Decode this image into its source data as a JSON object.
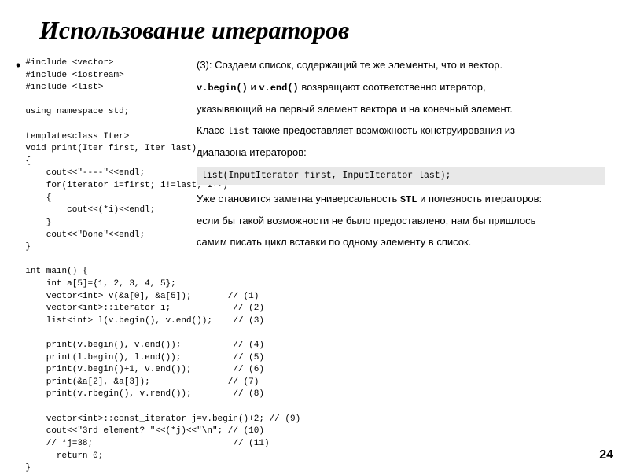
{
  "title": "Использование итераторов",
  "left_code": "#include <vector>\n#include <iostream>\n#include <list>\n\nusing namespace std;\n\ntemplate<class Iter>\nvoid print(Iter first, Iter last)\n{\n    cout<<\"----\"<<endl;\n    for(iterator i=first; i!=last; i++)\n    {\n        cout<<(*i)<<endl;\n    }\n    cout<<\"Done\"<<endl;\n}\n\nint main() {\n    int a[5]={1, 2, 3, 4, 5};\n    vector<int> v(&a[0], &a[5]);            // (1)\n    vector<int>::iterator i;                // (2)\n    list<int> l(v.begin(), v.end());        // (3)\n\n    print(v.begin(), v.end());              // (4)\n    print(l.begin(), l.end());              // (5)\n    print(v.begin()+1, v.end());            // (6)\n    print(&a[2], &a[3]);                    // (7)\n    print(v.rbegin(), v.rend());            // (8)\n\n    vector<int>::const_iterator j=v.begin()+2;   // (9)\n    cout<<\"3rd element? \"<<(*j)<<\"\\n\";           // (10)\n    // *j=38;                                     // (11)\n      return 0;",
  "right_text_1": "(3): Создаем список, содержащий те же элементы, что и вектор.",
  "right_text_2": "v.begin() и v.end() возвращают соответственно итератор,",
  "right_text_3": "указывающий на первый элемент вектора и на конечный элемент.",
  "right_text_4": "Класс list также предоставляет возможность конструирования из",
  "right_text_5": "диапазона итераторов:",
  "right_code": "list(InputIterator first, InputIterator last);",
  "right_text_6": "Уже становится заметна универсальность STL и полезность итераторов:",
  "right_text_7": "если бы такой возможности не было предоставлено, нам бы пришлось",
  "right_text_8": "самим писать цикл вставки по одному элементу в список.",
  "page_number": "24",
  "bullet_symbol": "•"
}
